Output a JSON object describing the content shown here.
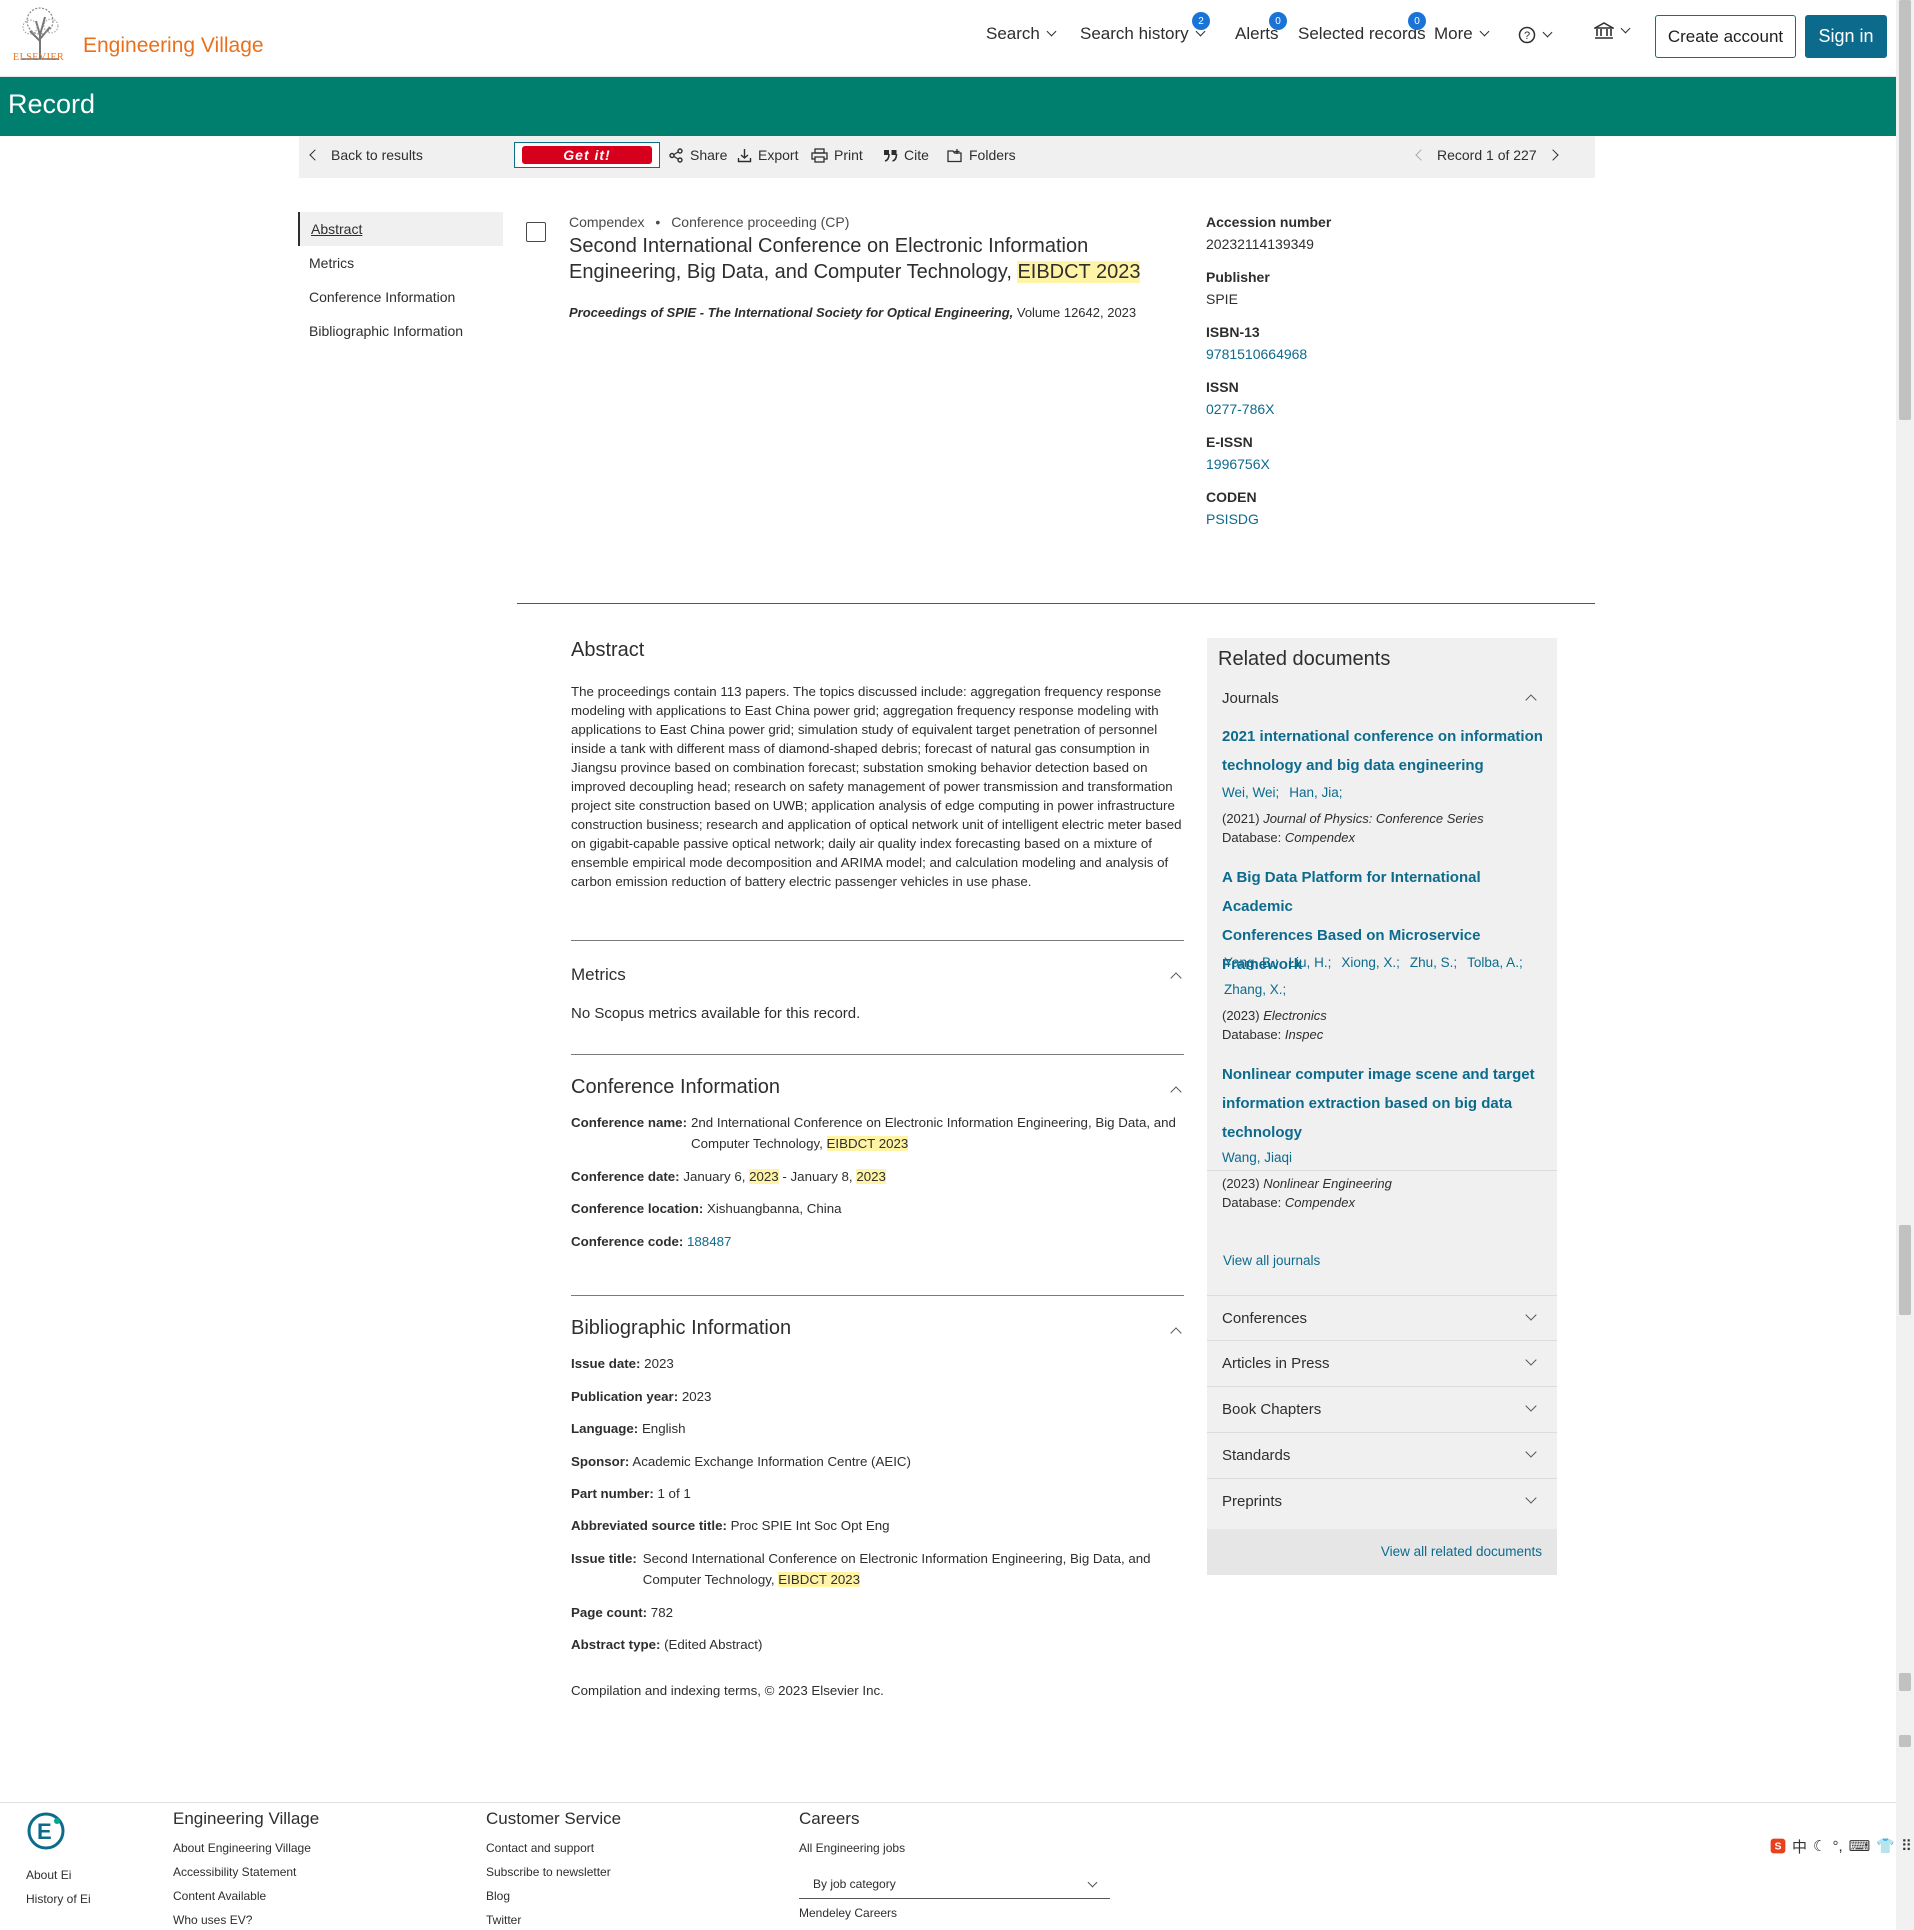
{
  "header": {
    "logo_word": "ELSEVIER",
    "brand": "Engineering Village",
    "nav": {
      "search": "Search",
      "history": "Search history",
      "history_count": "2",
      "alerts": "Alerts",
      "alerts_count": "0",
      "selected": "Selected records",
      "selected_count": "0",
      "more": "More",
      "help_icon": "help-circle-icon",
      "institution_icon": "institution-icon"
    },
    "create_account": "Create account",
    "sign_in": "Sign in"
  },
  "page_title": "Record",
  "toolbar": {
    "back": "Back to results",
    "getit": "Get it!",
    "share": "Share",
    "export": "Export",
    "print": "Print",
    "cite": "Cite",
    "folders": "Folders",
    "record_pos": "Record 1 of 227"
  },
  "sidenav": [
    "Abstract",
    "Metrics",
    "Conference Information",
    "Bibliographic Information"
  ],
  "record": {
    "database": "Compendex",
    "doc_type": "Conference proceeding (CP)",
    "title_main": "Second International Conference on Electronic Information Engineering, Big Data, and Computer Technology, ",
    "title_hl": "EIBDCT 2023",
    "source_italic": "Proceedings of SPIE - The International Society for Optical Engineering,",
    "source_rest": " Volume 12642, 2023"
  },
  "facts": {
    "accession_label": "Accession number",
    "accession": "20232114139349",
    "publisher_label": "Publisher",
    "publisher": "SPIE",
    "isbn_label": "ISBN-13",
    "isbn": "9781510664968",
    "issn_label": "ISSN",
    "issn": "0277-786X",
    "eissn_label": "E-ISSN",
    "eissn": "1996756X",
    "coden_label": "CODEN",
    "coden": "PSISDG"
  },
  "abstract": {
    "heading": "Abstract",
    "text": "The proceedings contain 113 papers. The topics discussed include: aggregation frequency response modeling with applications to East China power grid; aggregation frequency response modeling with applications to East China power grid; simulation study of equivalent target penetration of personnel inside a tank with different mass of diamond-shaped debris; forecast of natural gas consumption in Jiangsu province based on combination forecast; substation smoking behavior detection based on improved decoupling head; research on safety management of power transmission and transformation project site construction based on UWB; application analysis of edge computing in power infrastructure construction business; research and application of optical network unit of intelligent electric meter based on gigabit-capable passive optical network; daily air quality index forecasting based on a mixture of ensemble empirical mode decomposition and ARIMA model; and calculation modeling and analysis of carbon emission reduction of battery electric passenger vehicles in use phase."
  },
  "metrics": {
    "heading": "Metrics",
    "text": "No Scopus metrics available for this record."
  },
  "conference": {
    "heading": "Conference Information",
    "name_label": "Conference name:",
    "name_1": "2nd International Conference on Electronic Information Engineering, Big Data, and",
    "name_2": "Computer Technology, ",
    "name_hl": "EIBDCT 2023",
    "date_label": "Conference date:",
    "date_a": "January 6, ",
    "date_y1": "2023",
    "date_b": " - January 8, ",
    "date_y2": "2023",
    "location_label": "Conference location:",
    "location": "Xishuangbanna, China",
    "code_label": "Conference code:",
    "code": "188487"
  },
  "biblio": {
    "heading": "Bibliographic Information",
    "issue_date_label": "Issue date:",
    "issue_date": "2023",
    "pub_year_label": "Publication year:",
    "pub_year": "2023",
    "language_label": "Language:",
    "language": "English",
    "sponsor_label": "Sponsor:",
    "sponsor": "Academic Exchange Information Centre (AEIC)",
    "part_label": "Part number:",
    "part": "1 of 1",
    "abbr_label": "Abbreviated source title:",
    "abbr": "Proc SPIE Int Soc Opt Eng",
    "issue_title_label": "Issue title:",
    "issue_title_1": "Second International Conference on Electronic Information Engineering, Big Data, and",
    "issue_title_2": "Computer Technology, ",
    "issue_title_hl": "EIBDCT 2023",
    "page_count_label": "Page count:",
    "page_count": "782",
    "abstract_type_label": "Abstract type:",
    "abstract_type": "(Edited Abstract)",
    "copyright": "Compilation and indexing terms, © 2023 Elsevier Inc."
  },
  "related": {
    "heading": "Related documents",
    "journals": "Journals",
    "docs": [
      {
        "title_1": "2021 international conference on information",
        "title_2": "technology and big data engineering",
        "authors": [
          "Wei, Wei;",
          "Han, Jia;"
        ],
        "year": "(2021)",
        "source": "Journal of Physics: Conference Series",
        "db_label": "Database:",
        "db": "Compendex"
      },
      {
        "title_1": "A Big Data Platform for International Academic",
        "title_2": "Conferences Based on Microservice",
        "title_3": "Framework",
        "authors": [
          "Yang, B.;",
          "Liu, H.;",
          "Xiong, X.;",
          "Zhu, S.;",
          "Tolba, A.;"
        ],
        "authors_2": [
          "Zhang, X.;"
        ],
        "year": "(2023)",
        "source": "Electronics",
        "db_label": "Database:",
        "db": "Inspec"
      },
      {
        "title_1": "Nonlinear computer image scene and target",
        "title_2": "information extraction based on big data",
        "title_3": "technology",
        "authors": [
          "Wang, Jiaqi"
        ],
        "year": "(2023)",
        "source": "Nonlinear Engineering",
        "db_label": "Database:",
        "db": "Compendex"
      }
    ],
    "view_all_journals": "View all journals",
    "sections": [
      "Conferences",
      "Articles in Press",
      "Book Chapters",
      "Standards",
      "Preprints"
    ],
    "view_all": "View all related documents"
  },
  "footer": {
    "ei_links": [
      "About Ei",
      "History of Ei"
    ],
    "col1_head": "Engineering Village",
    "col1": [
      "About Engineering Village",
      "Accessibility Statement",
      "Content Available",
      "Who uses EV?"
    ],
    "col2_head": "Customer Service",
    "col2": [
      "Contact and support",
      "Subscribe to newsletter",
      "Blog",
      "Twitter"
    ],
    "col3_head": "Careers",
    "col3_link": "All Engineering jobs",
    "col3_select": "By job category",
    "col3_link2": "Mendeley Careers"
  },
  "ime": {
    "lang": "中"
  }
}
